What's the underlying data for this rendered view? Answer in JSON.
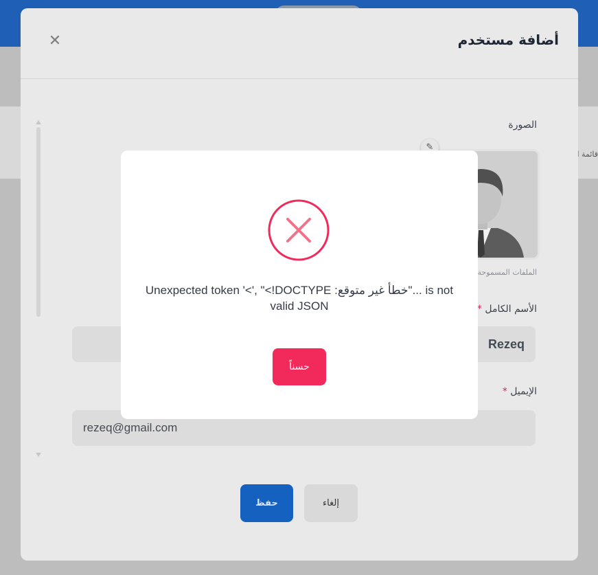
{
  "background": {
    "side_text": "قائمة المستخدمين"
  },
  "modal": {
    "title": "أضافة مستخدم",
    "close_icon": "close-icon",
    "photo_label": "الصورة",
    "allowed_files": "الملفات المسموحة",
    "full_name_label": "الأسم الكامل",
    "full_name_value": "Rezeq",
    "email_label": "الإيميل",
    "email_value": "rezeq@gmail.com",
    "required_mark": "*",
    "save_button": "حفظ",
    "cancel_button": "إلغاء"
  },
  "dialog": {
    "icon": "error-x-icon",
    "message": "Unexpected token '<', \"<!DOCTYPE :خطأ غير متوقع\"... is not valid JSON",
    "ok_button": "حسناً"
  },
  "colors": {
    "error": "#f2295b",
    "primary": "#1561c0"
  }
}
